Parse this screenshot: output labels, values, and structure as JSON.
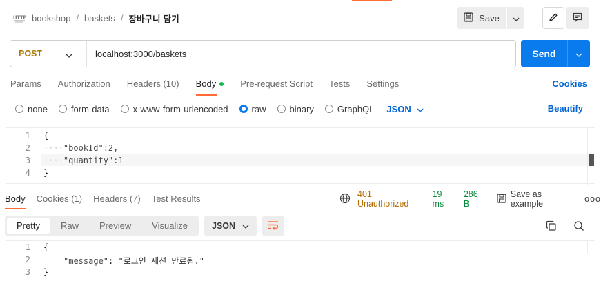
{
  "breadcrumb": {
    "collection": "bookshop",
    "folder": "baskets",
    "request": "장바구니 담기"
  },
  "toolbar": {
    "save_label": "Save"
  },
  "request": {
    "method": "POST",
    "url": "localhost:3000/baskets",
    "send_label": "Send"
  },
  "request_tabs": {
    "params": "Params",
    "authorization": "Authorization",
    "headers": "Headers (10)",
    "body": "Body",
    "prerequest": "Pre-request Script",
    "tests": "Tests",
    "settings": "Settings",
    "cookies": "Cookies"
  },
  "body_options": {
    "none": "none",
    "form_data": "form-data",
    "urlencoded": "x-www-form-urlencoded",
    "raw": "raw",
    "binary": "binary",
    "graphql": "GraphQL",
    "language": "JSON",
    "beautify": "Beautify",
    "selected": "raw"
  },
  "request_body": {
    "line_numbers": [
      "1",
      "2",
      "3",
      "4"
    ],
    "lines": [
      "{",
      "\"bookId\":2,",
      "\"quantity\":1",
      "}"
    ]
  },
  "response_tabs": {
    "body": "Body",
    "cookies": "Cookies (1)",
    "headers": "Headers (7)",
    "test_results": "Test Results"
  },
  "response_meta": {
    "status": "401 Unauthorized",
    "time": "19 ms",
    "size": "286 B",
    "save_example": "Save as example",
    "more": "ooo"
  },
  "response_view": {
    "pretty": "Pretty",
    "raw": "Raw",
    "preview": "Preview",
    "visualize": "Visualize",
    "format": "JSON"
  },
  "response_body": {
    "line_numbers": [
      "1",
      "2",
      "3"
    ],
    "open": "{",
    "key": "\"message\"",
    "colon": ": ",
    "value": "\"로그인 세션 만료됨.\"",
    "close": "}"
  },
  "colors": {
    "accent": "#ff6c37",
    "primary": "#097bed",
    "link": "#0265d2",
    "method": "#ad7a03",
    "status_error": "#b26c00",
    "status_ok": "#0a8a3f"
  }
}
